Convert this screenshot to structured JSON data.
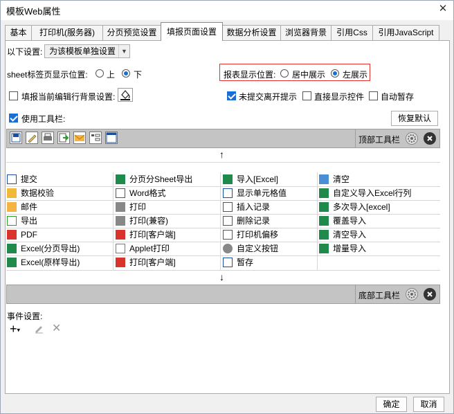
{
  "window": {
    "title": "模板Web属性"
  },
  "tabs": [
    {
      "label": "基本"
    },
    {
      "label": "打印机(服务器)"
    },
    {
      "label": "分页预览设置"
    },
    {
      "label": "填报页面设置"
    },
    {
      "label": "数据分析设置"
    },
    {
      "label": "浏览器背景"
    },
    {
      "label": "引用Css"
    },
    {
      "label": "引用JavaScript"
    }
  ],
  "settings": {
    "below_label": "以下设置:",
    "below_value": "为该模板单独设置",
    "sheet_pos_label": "sheet标签页显示位置:",
    "sheet_pos_options": [
      "上",
      "下"
    ],
    "report_pos_label": "报表显示位置:",
    "report_pos_options": [
      "居中展示",
      "左展示"
    ],
    "fill_bg_label": "填报当前编辑行背景设置:",
    "unsubmit_label": "未提交离开提示",
    "direct_ctrl_label": "直接显示控件",
    "autosave_label": "自动暂存",
    "use_toolbar_label": "使用工具栏:",
    "restore_label": "恢复默认"
  },
  "toolbars": {
    "top_label": "顶部工具栏",
    "bottom_label": "底部工具栏"
  },
  "items": {
    "col1": [
      "提交",
      "数据校验",
      "邮件",
      "导出",
      "PDF",
      "Excel(分页导出)",
      "Excel(原样导出)"
    ],
    "col2": [
      "分页分Sheet导出",
      "Word格式",
      "打印",
      "打印(兼容)",
      "打印[客户端]",
      "Applet打印",
      "打印[客户端]"
    ],
    "col3": [
      "导入[Excel]",
      "显示单元格值",
      "插入记录",
      "删除记录",
      "打印机偏移",
      "自定义按钮",
      "暂存"
    ],
    "col4": [
      "清空",
      "自定义导入Excel行列",
      "多次导入[excel]",
      "覆盖导入",
      "清空导入",
      "增量导入"
    ]
  },
  "events": {
    "label": "事件设置:"
  },
  "footer": {
    "ok": "确定",
    "cancel": "取消"
  },
  "colors": {
    "accent": "#1a6fd6",
    "highlight": "#e0312b"
  }
}
